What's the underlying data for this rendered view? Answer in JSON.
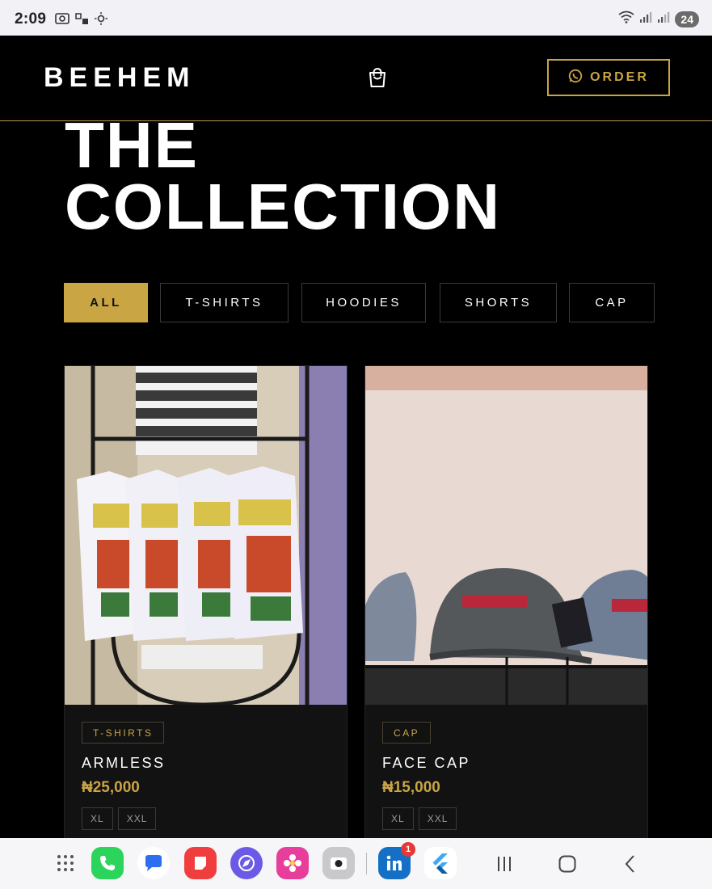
{
  "status_bar": {
    "time": "2:09",
    "battery": "24"
  },
  "nav": {
    "brand": "BEEHEM",
    "order_label": "ORDER"
  },
  "heading": {
    "line1": "THE",
    "line2": "COLLECTION"
  },
  "filters": [
    {
      "label": "ALL",
      "active": true
    },
    {
      "label": "T-SHIRTS",
      "active": false
    },
    {
      "label": "HOODIES",
      "active": false
    },
    {
      "label": "SHORTS",
      "active": false
    },
    {
      "label": "CAP",
      "active": false
    }
  ],
  "products": [
    {
      "category": "T-SHIRTS",
      "name": "ARMLESS",
      "price": "₦25,000",
      "sizes": [
        "XL",
        "XXL"
      ]
    },
    {
      "category": "CAP",
      "name": "FACE CAP",
      "price": "₦15,000",
      "sizes": [
        "XL",
        "XXL"
      ]
    }
  ],
  "dock": {
    "linkedin_badge": "1"
  },
  "colors": {
    "accent_gold": "#c9a544",
    "background": "#000000",
    "card": "#121212"
  }
}
